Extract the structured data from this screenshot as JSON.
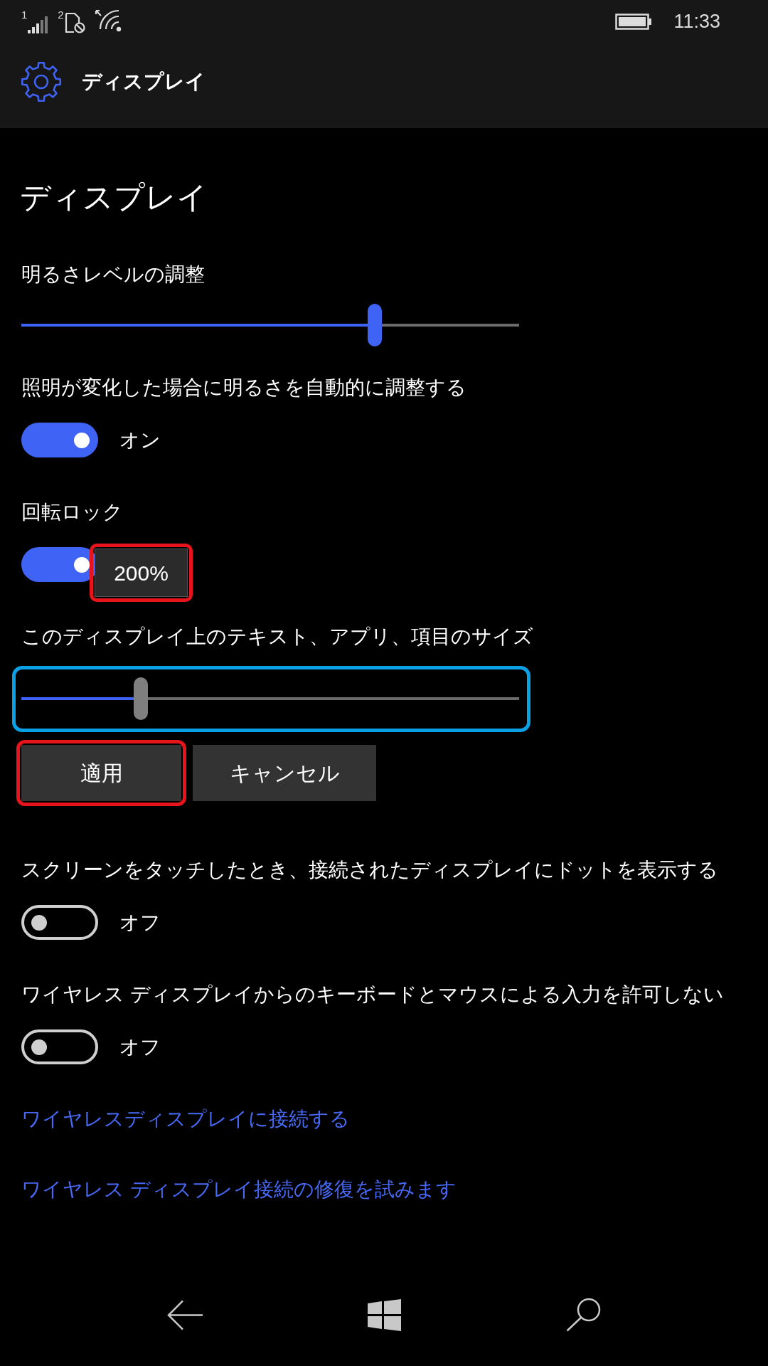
{
  "status_bar": {
    "sim_1_label": "1",
    "sim_2_label": "2",
    "time": "11:33"
  },
  "header": {
    "title": "ディスプレイ"
  },
  "page_title": "ディスプレイ",
  "settings": [
    {
      "kind": "slider",
      "label": "明るさレベルの調整",
      "level": 0.71,
      "pressed": false,
      "outlined": false
    },
    {
      "kind": "toggle",
      "label": "照明が変化した場合に明るさを自動的に調整する",
      "on": true,
      "state_text": "オン"
    },
    {
      "kind": "toggle",
      "label": "回転ロック",
      "on": true
    },
    {
      "kind": "slider",
      "label": "このディスプレイ上のテキスト、アプリ、項目のサイズ",
      "level": 0.24,
      "pressed": true,
      "outlined": true,
      "tooltip": {
        "text": "200%",
        "highlighted": true
      }
    },
    {
      "kind": "buttons",
      "buttons": [
        {
          "label": "適用",
          "highlighted": true
        },
        {
          "label": "キャンセル",
          "highlighted": false
        }
      ]
    },
    {
      "kind": "toggle",
      "label": "スクリーンをタッチしたとき、接続されたディスプレイにドットを表示する",
      "on": false,
      "state_text": "オフ"
    },
    {
      "kind": "toggle",
      "label": "ワイヤレス ディスプレイからのキーボードとマウスによる入力を許可しない",
      "on": false,
      "state_text": "オフ"
    }
  ],
  "links": [
    "ワイヤレスディスプレイに接続する",
    "ワイヤレス ディスプレイ接続の修復を試みます"
  ]
}
